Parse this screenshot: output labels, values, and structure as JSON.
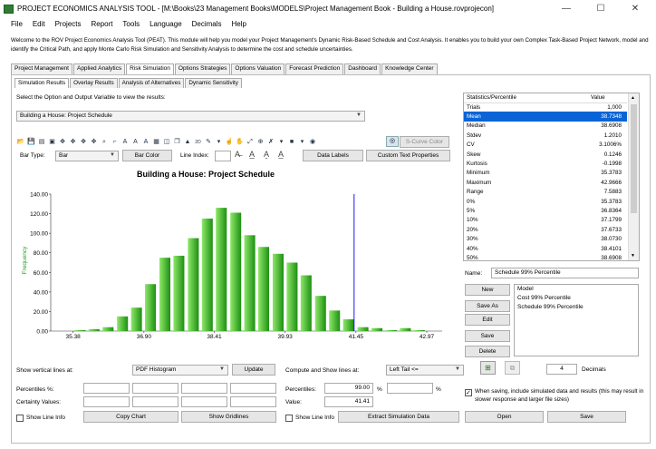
{
  "window": {
    "title": "PROJECT ECONOMICS ANALYSIS TOOL - [M:\\Books\\23 Management Books\\MODELS\\Project Management Book - Building a House.rovprojecon]",
    "minimize": "—",
    "maximize": "☐",
    "close": "✕"
  },
  "menu": [
    "File",
    "Edit",
    "Projects",
    "Report",
    "Tools",
    "Language",
    "Decimals",
    "Help"
  ],
  "intro": "Welcome to the ROV Project Economics Analysis Tool (PEAT). This module will help you model your Project Management's Dynamic Risk-Based Schedule and Cost Analysis. It enables you to build your own Complex Task-Based Project Network, model and identify the Critical Path, and apply Monte Carlo Risk Simulation and Sensitivity Analysis to determine the cost and schedule uncertainties.",
  "tabs": [
    "Project Management",
    "Applied Analytics",
    "Risk Simulation",
    "Options Strategies",
    "Options Valuation",
    "Forecast Prediction",
    "Dashboard",
    "Knowledge Center"
  ],
  "subtabs": [
    "Simulation Results",
    "Overlay Results",
    "Analysis of Alternatives",
    "Dynamic Sensitivity"
  ],
  "select_prompt": "Select the Option and Output Variable to view the results:",
  "output_variable": "Building a House: Project Schedule",
  "toolbar": {
    "scurve_label": "S-Curve Color",
    "bar_type_label": "Bar Type:",
    "bar_type_value": "Bar",
    "bar_color_label": "Bar Color",
    "line_index_label": "Line Index:",
    "data_labels": "Data Labels",
    "custom_text": "Custom Text Properties"
  },
  "chart_data": {
    "type": "bar",
    "title": "Building a House: Project Schedule",
    "ylabel": "Frequency",
    "ylim": [
      0,
      140
    ],
    "yticks": [
      "0.00",
      "20.00",
      "40.00",
      "60.00",
      "80.00",
      "100.00",
      "120.00",
      "140.00"
    ],
    "xticks": [
      "35.38",
      "36.90",
      "38.41",
      "39.93",
      "41.45",
      "42.97"
    ],
    "xlim": [
      34.9,
      43.3
    ],
    "bar_centers": [
      35.53,
      35.83,
      36.13,
      36.44,
      36.74,
      37.04,
      37.35,
      37.65,
      37.96,
      38.26,
      38.56,
      38.87,
      39.17,
      39.47,
      39.78,
      40.08,
      40.38,
      40.69,
      40.99,
      41.29,
      41.6,
      41.9,
      42.21,
      42.51,
      42.81
    ],
    "values": [
      1,
      2,
      4,
      15,
      24,
      48,
      75,
      77,
      95,
      115,
      126,
      121,
      98,
      86,
      79,
      70,
      57,
      36,
      21,
      12,
      4,
      3,
      1,
      3,
      1
    ],
    "vline": 41.41,
    "colors": {
      "bar_light": "#8ee86a",
      "bar_dark": "#1d8f12",
      "vline": "#1a1aff",
      "ylabel": "#1f9f1f"
    }
  },
  "stats": {
    "headers": [
      "Statistics/Percentile",
      "Value"
    ],
    "rows": [
      [
        "Trials",
        "1,000"
      ],
      [
        "Mean",
        "38.7348"
      ],
      [
        "Median",
        "38.6908"
      ],
      [
        "Stdev",
        "1.2010"
      ],
      [
        "CV",
        "3.1006%"
      ],
      [
        "Skew",
        "0.1246"
      ],
      [
        "Kurtosis",
        "-0.1998"
      ],
      [
        "Minimum",
        "35.3783"
      ],
      [
        "Maximum",
        "42.9666"
      ],
      [
        "Range",
        "7.5883"
      ],
      [
        "0%",
        "35.3783"
      ],
      [
        "5%",
        "36.8364"
      ],
      [
        "10%",
        "37.1799"
      ],
      [
        "20%",
        "37.6733"
      ],
      [
        "30%",
        "38.0730"
      ],
      [
        "40%",
        "38.4101"
      ],
      [
        "50%",
        "38.6908"
      ]
    ],
    "selected": "Mean"
  },
  "name_label": "Name:",
  "name_value": "Schedule 99% Percentile",
  "side_buttons": [
    "New",
    "Save As",
    "Edit",
    "Save",
    "Delete"
  ],
  "models": [
    "Model",
    "Cost 99% Percentile",
    "Schedule 99% Percentile"
  ],
  "bottom": {
    "show_vlines_label": "Show vertical lines at:",
    "show_vlines_value": "PDF Histogram",
    "update": "Update",
    "compute_label": "Compute and Show lines at:",
    "compute_value": "Left Tail <=",
    "decimals_value": "4",
    "decimals_label": "Decimals",
    "percentiles_pct_label": "Percentiles %:",
    "certainty_label": "Certainty Values:",
    "percentiles_label": "Percentiles:",
    "percentiles_value": "99.00",
    "pct_sign": "%",
    "pct_sign2": "%",
    "value_label": "Value:",
    "value_value": "41.41",
    "save_note": "When saving, include simulated data and results (this may result in slower response and larger file sizes)",
    "show_line_info": "Show Line Info",
    "copy_chart": "Copy Chart",
    "show_gridlines": "Show Gridlines",
    "show_line_info2": "Show Line Info",
    "extract": "Extract Simulation Data",
    "open": "Open",
    "save": "Save"
  }
}
